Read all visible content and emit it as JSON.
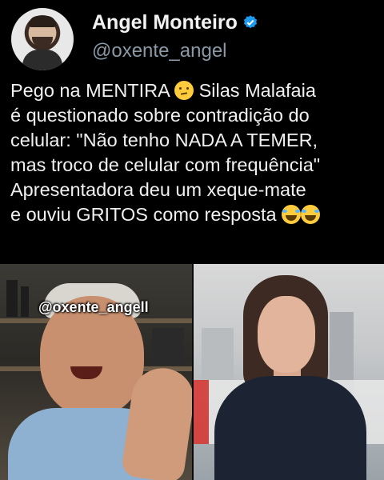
{
  "author": {
    "name": "Angel Monteiro",
    "handle": "@oxente_angel",
    "verified_badge_color": "#1d9bf0"
  },
  "tweet": {
    "lines": [
      "Pego na MENTIRA",
      "Silas Malafaia",
      "é questionado sobre contradição do",
      "celular: \"Não tenho NADA A TEMER,",
      "mas troco de celular com frequência\"",
      "Apresentadora deu um xeque-mate",
      "e ouviu GRITOS como resposta"
    ],
    "emojis": [
      "thinking-lying-face-icon",
      "joy-icon",
      "joy-icon"
    ]
  },
  "video": {
    "watermark": "@oxente_angell",
    "accent_color": "#d8332e"
  }
}
